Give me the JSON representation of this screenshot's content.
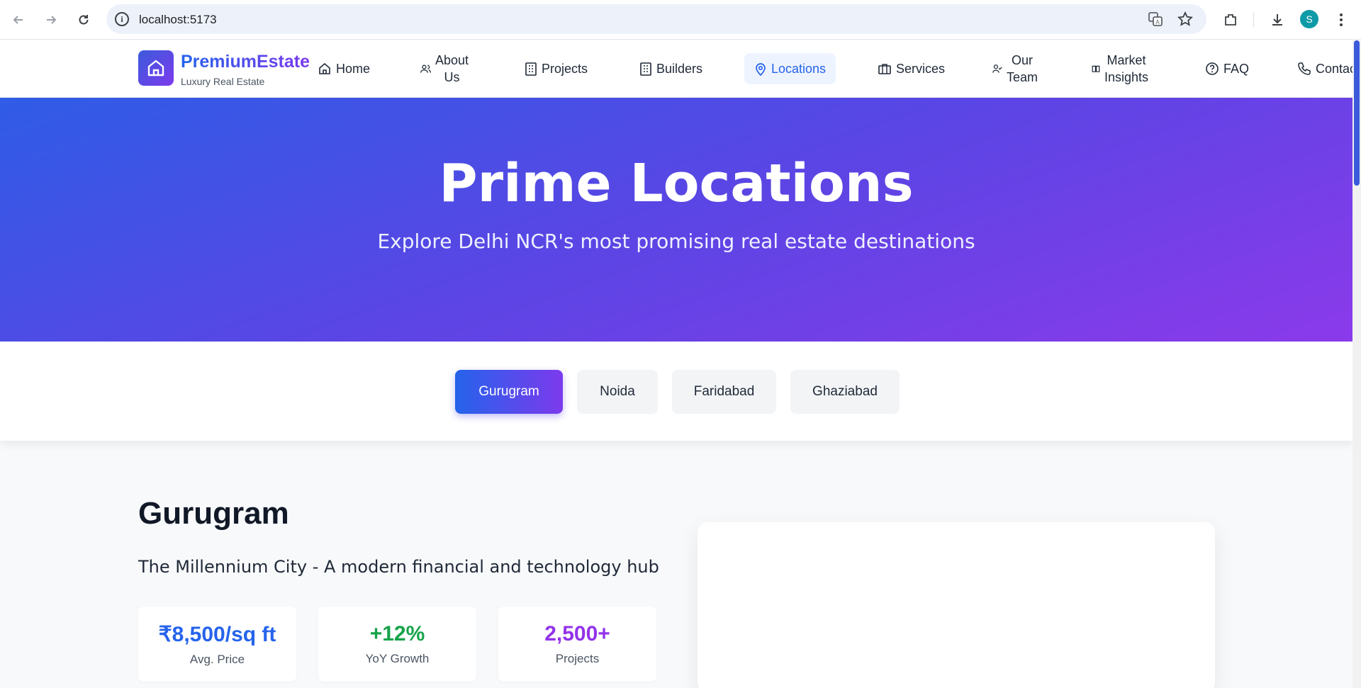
{
  "browser": {
    "url": "localhost:5173",
    "profile_initial": "S"
  },
  "header": {
    "brand": "PremiumEstate",
    "tagline": "Luxury Real Estate",
    "nav": [
      {
        "label": "Home",
        "icon": "home-icon"
      },
      {
        "label": "About\nUs",
        "icon": "users-icon"
      },
      {
        "label": "Projects",
        "icon": "building-icon"
      },
      {
        "label": "Builders",
        "icon": "building-icon"
      },
      {
        "label": "Locations",
        "icon": "map-pin-icon",
        "active": true
      },
      {
        "label": "Services",
        "icon": "briefcase-icon"
      },
      {
        "label": "Our\nTeam",
        "icon": "user-check-icon"
      },
      {
        "label": "Market\nInsights",
        "icon": "book-icon"
      },
      {
        "label": "FAQ",
        "icon": "help-circle-icon"
      },
      {
        "label": "Contac",
        "icon": "phone-icon"
      }
    ]
  },
  "hero": {
    "title": "Prime Locations",
    "subtitle": "Explore Delhi NCR's most promising real estate destinations"
  },
  "city_tabs": [
    {
      "label": "Gurugram",
      "active": true
    },
    {
      "label": "Noida"
    },
    {
      "label": "Faridabad"
    },
    {
      "label": "Ghaziabad"
    }
  ],
  "city": {
    "name": "Gurugram",
    "description": "The Millennium City - A modern financial and technology hub",
    "stats": [
      {
        "value": "₹8,500/sq ft",
        "label": "Avg. Price",
        "color": "#2563eb"
      },
      {
        "value": "+12%",
        "label": "YoY Growth",
        "color": "#16a34a"
      },
      {
        "value": "2,500+",
        "label": "Projects",
        "color": "#9333ea"
      }
    ]
  },
  "colors": {
    "accent": "#2563eb",
    "accent2": "#7c3aed"
  }
}
